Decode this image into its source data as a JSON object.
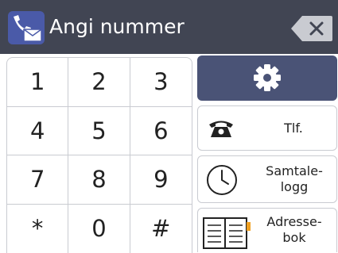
{
  "header": {
    "title": "Angi nummer",
    "colors": {
      "background": "#414553",
      "icon_bg": "#4a5aa8",
      "backspace": "#c9cbd1"
    },
    "icons": {
      "app": "phone-fax-icon",
      "backspace": "backspace-icon"
    }
  },
  "keypad": {
    "keys": [
      "1",
      "2",
      "3",
      "4",
      "5",
      "6",
      "7",
      "8",
      "9",
      "*",
      "0",
      "#"
    ]
  },
  "buttons": {
    "settings": {
      "icon": "gear-icon",
      "color": "#4a5376"
    },
    "phone": {
      "label": "Tlf.",
      "icon": "telephone-icon"
    },
    "call_log": {
      "line1": "Samtale-",
      "line2": "logg",
      "icon": "clock-icon"
    },
    "address_book": {
      "line1": "Adresse-",
      "line2": "bok",
      "icon": "address-book-icon",
      "accent": "#f0a020"
    }
  }
}
